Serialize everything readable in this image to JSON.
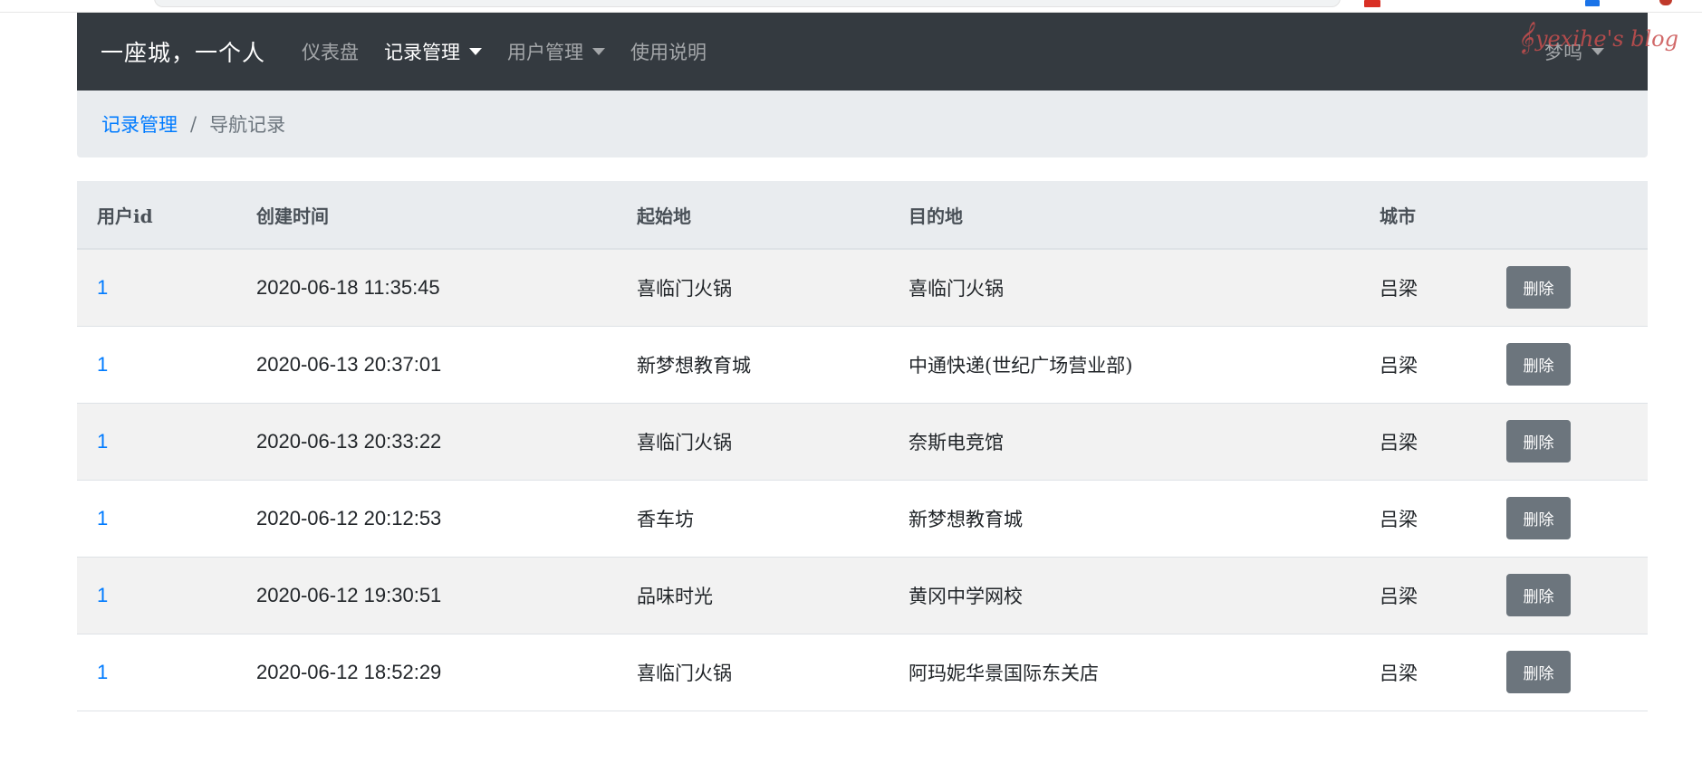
{
  "navbar": {
    "brand": "一座城，一个人",
    "items": [
      {
        "label": "仪表盘",
        "dropdown": false,
        "active": false
      },
      {
        "label": "记录管理",
        "dropdown": true,
        "active": true
      },
      {
        "label": "用户管理",
        "dropdown": true,
        "active": false
      },
      {
        "label": "使用说明",
        "dropdown": false,
        "active": false
      }
    ],
    "user": {
      "label": "梦呜"
    }
  },
  "watermark": {
    "text": "yexihe's blog",
    "clef": "𝄞",
    "color": "#c94f4f"
  },
  "breadcrumb": {
    "parent": "记录管理",
    "separator": "/",
    "current": "导航记录"
  },
  "table": {
    "headers": [
      "用户id",
      "创建时间",
      "起始地",
      "目的地",
      "城市",
      ""
    ],
    "rows": [
      {
        "user_id": "1",
        "created": "2020-06-18 11:35:45",
        "origin": "喜临门火锅",
        "destination": "喜临门火锅",
        "city": "吕梁",
        "action": "删除"
      },
      {
        "user_id": "1",
        "created": "2020-06-13 20:37:01",
        "origin": "新梦想教育城",
        "destination": "中通快递(世纪广场营业部)",
        "city": "吕梁",
        "action": "删除"
      },
      {
        "user_id": "1",
        "created": "2020-06-13 20:33:22",
        "origin": "喜临门火锅",
        "destination": "奈斯电竞馆",
        "city": "吕梁",
        "action": "删除"
      },
      {
        "user_id": "1",
        "created": "2020-06-12 20:12:53",
        "origin": "香车坊",
        "destination": "新梦想教育城",
        "city": "吕梁",
        "action": "删除"
      },
      {
        "user_id": "1",
        "created": "2020-06-12 19:30:51",
        "origin": "品味时光",
        "destination": "黄冈中学网校",
        "city": "吕梁",
        "action": "删除"
      },
      {
        "user_id": "1",
        "created": "2020-06-12 18:52:29",
        "origin": "喜临门火锅",
        "destination": "阿玛妮华景国际东关店",
        "city": "吕梁",
        "action": "删除"
      }
    ]
  },
  "colors": {
    "navbar_bg": "#343a40",
    "link": "#007bff",
    "button_secondary": "#6c757d",
    "breadcrumb_bg": "#e9ecef"
  }
}
